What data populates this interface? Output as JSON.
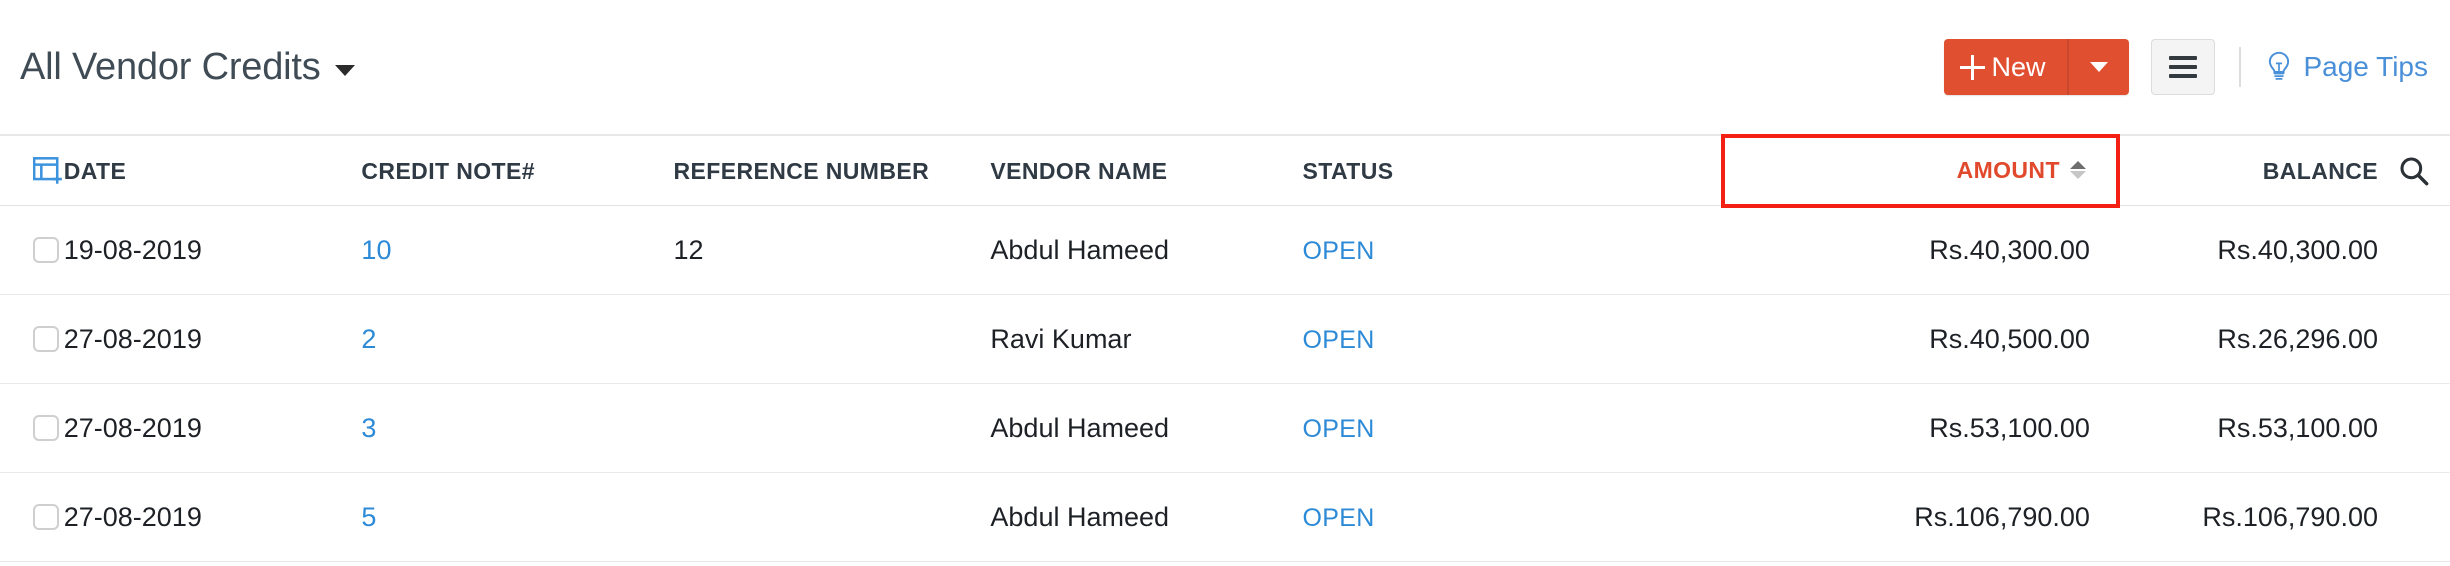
{
  "header": {
    "title": "All Vendor Credits",
    "new_button_label": "New",
    "page_tips_label": "Page Tips"
  },
  "table": {
    "columns": [
      {
        "key": "date",
        "label": "DATE"
      },
      {
        "key": "note",
        "label": "CREDIT NOTE#"
      },
      {
        "key": "ref",
        "label": "REFERENCE NUMBER"
      },
      {
        "key": "vendor",
        "label": "VENDOR NAME"
      },
      {
        "key": "status",
        "label": "STATUS"
      },
      {
        "key": "amount",
        "label": "AMOUNT"
      },
      {
        "key": "balance",
        "label": "BALANCE"
      }
    ],
    "sort": {
      "column": "AMOUNT",
      "direction": "asc",
      "highlight_color": "#f32013",
      "label_color": "#e0492c"
    },
    "rows": [
      {
        "date": "19-08-2019",
        "credit_note": "10",
        "reference_number": "12",
        "vendor_name": "Abdul Hameed",
        "status": "OPEN",
        "amount": "Rs.40,300.00",
        "balance": "Rs.40,300.00"
      },
      {
        "date": "27-08-2019",
        "credit_note": "2",
        "reference_number": "",
        "vendor_name": "Ravi Kumar",
        "status": "OPEN",
        "amount": "Rs.40,500.00",
        "balance": "Rs.26,296.00"
      },
      {
        "date": "27-08-2019",
        "credit_note": "3",
        "reference_number": "",
        "vendor_name": "Abdul Hameed",
        "status": "OPEN",
        "amount": "Rs.53,100.00",
        "balance": "Rs.53,100.00"
      },
      {
        "date": "27-08-2019",
        "credit_note": "5",
        "reference_number": "",
        "vendor_name": "Abdul Hameed",
        "status": "OPEN",
        "amount": "Rs.106,790.00",
        "balance": "Rs.106,790.00"
      }
    ]
  },
  "icons": {
    "title_caret": "chevron-down-icon",
    "new_plus": "plus-icon",
    "new_caret": "chevron-down-icon",
    "menu": "hamburger-icon",
    "page_tips": "lightbulb-icon",
    "column_settings": "add-column-icon",
    "search": "search-icon",
    "row_select": "checkbox-icon"
  },
  "colors": {
    "accent_red": "#e14f31",
    "link_blue": "#2c8ad6",
    "page_tips_blue": "#4a90d9",
    "sort_highlight": "#f32013"
  }
}
